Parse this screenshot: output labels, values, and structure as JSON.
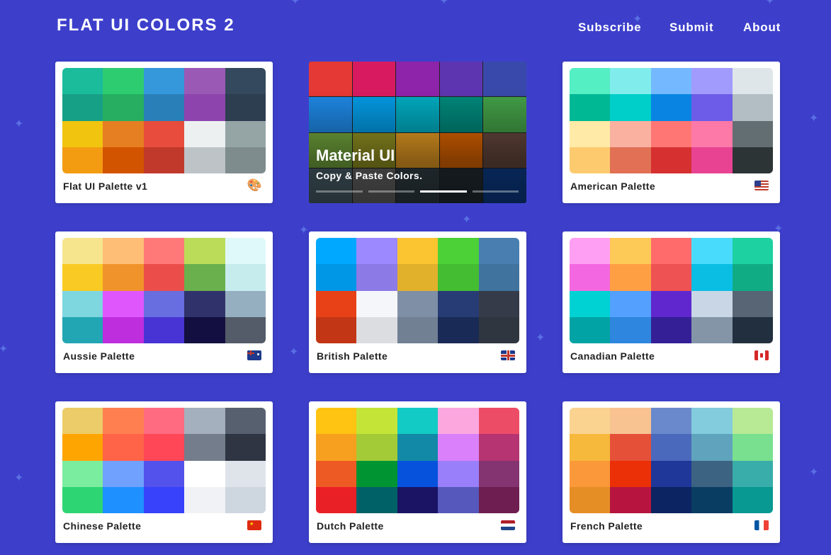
{
  "header": {
    "logo": "FLAT UI COLORS 2",
    "nav": [
      "Subscribe",
      "Submit",
      "About"
    ]
  },
  "featured": {
    "title": "Material UI",
    "subtitle": "Copy & Paste Colors.",
    "colors": [
      "#e53935",
      "#d81b60",
      "#8e24aa",
      "#5e35b1",
      "#3949ab",
      "#1e88e5",
      "#039be5",
      "#00acc1",
      "#00897b",
      "#43a047",
      "#7cb342",
      "#9e9d24",
      "#f9a825",
      "#ef6c00",
      "#6d4c41",
      "#546e7a",
      "#757575",
      "#37474f",
      "#263238",
      "#0d47a1"
    ],
    "carousel_active": 2,
    "carousel_count": 4
  },
  "palettes": [
    {
      "name": "Flat UI Palette v1",
      "icon": "palette-icon",
      "colors": [
        "#1abc9c",
        "#2ecc71",
        "#3498db",
        "#9b59b6",
        "#34495e",
        "#16a085",
        "#27ae60",
        "#2980b9",
        "#8e44ad",
        "#2c3e50",
        "#f1c40f",
        "#e67e22",
        "#e74c3c",
        "#ecf0f1",
        "#95a5a6",
        "#f39c12",
        "#d35400",
        "#c0392b",
        "#bdc3c7",
        "#7f8c8d"
      ]
    },
    {
      "name": "American Palette",
      "icon": "us-flag-icon",
      "colors": [
        "#55efc4",
        "#81ecec",
        "#74b9ff",
        "#a29bfe",
        "#dfe6e9",
        "#00b894",
        "#00cec9",
        "#0984e3",
        "#6c5ce7",
        "#b2bec3",
        "#ffeaa7",
        "#fab1a0",
        "#ff7675",
        "#fd79a8",
        "#636e72",
        "#fdcb6e",
        "#e17055",
        "#d63031",
        "#e84393",
        "#2d3436"
      ]
    },
    {
      "name": "Aussie Palette",
      "icon": "au-flag-icon",
      "colors": [
        "#f6e58d",
        "#ffbe76",
        "#ff7979",
        "#badc58",
        "#dff9fb",
        "#f9ca24",
        "#f0932b",
        "#eb4d4b",
        "#6ab04c",
        "#c7ecee",
        "#7ed6df",
        "#e056fd",
        "#686de0",
        "#30336b",
        "#95afc0",
        "#22a6b3",
        "#be2edd",
        "#4834d4",
        "#130f40",
        "#535c68"
      ]
    },
    {
      "name": "British Palette",
      "icon": "gb-flag-icon",
      "colors": [
        "#00a8ff",
        "#9c88ff",
        "#fbc531",
        "#4cd137",
        "#487eb0",
        "#0097e6",
        "#8c7ae6",
        "#e1b12c",
        "#44bd32",
        "#40739e",
        "#e84118",
        "#f5f6fa",
        "#7f8fa6",
        "#273c75",
        "#353b48",
        "#c23616",
        "#dcdde1",
        "#718093",
        "#192a56",
        "#2f3640"
      ]
    },
    {
      "name": "Canadian Palette",
      "icon": "ca-flag-icon",
      "colors": [
        "#ff9ff3",
        "#feca57",
        "#ff6b6b",
        "#48dbfb",
        "#1dd1a1",
        "#f368e0",
        "#ff9f43",
        "#ee5253",
        "#0abde3",
        "#10ac84",
        "#00d2d3",
        "#54a0ff",
        "#5f27cd",
        "#c8d6e5",
        "#576574",
        "#01a3a4",
        "#2e86de",
        "#341f97",
        "#8395a7",
        "#222f3e"
      ]
    },
    {
      "name": "Chinese Palette",
      "icon": "cn-flag-icon",
      "colors": [
        "#eccc68",
        "#ff7f50",
        "#ff6b81",
        "#a4b0be",
        "#57606f",
        "#ffa502",
        "#ff6348",
        "#ff4757",
        "#747d8c",
        "#2f3542",
        "#7bed9f",
        "#70a1ff",
        "#5352ed",
        "#ffffff",
        "#dfe4ea",
        "#2ed573",
        "#1e90ff",
        "#3742fa",
        "#f1f2f6",
        "#ced6e0"
      ]
    },
    {
      "name": "Dutch Palette",
      "icon": "nl-flag-icon",
      "colors": [
        "#ffc312",
        "#c4e538",
        "#12cbc4",
        "#fda7df",
        "#ed4c67",
        "#f79f1f",
        "#a3cb38",
        "#1289a7",
        "#d980fa",
        "#b53471",
        "#ee5a24",
        "#009432",
        "#0652dd",
        "#9980fa",
        "#833471",
        "#ea2027",
        "#006266",
        "#1b1464",
        "#5758bb",
        "#6f1e51"
      ]
    },
    {
      "name": "French Palette",
      "icon": "fr-flag-icon",
      "colors": [
        "#fad390",
        "#f8c291",
        "#6a89cc",
        "#82ccdd",
        "#b8e994",
        "#f6b93b",
        "#e55039",
        "#4a69bd",
        "#60a3bc",
        "#78e08f",
        "#fa983a",
        "#eb2f06",
        "#1e3799",
        "#3c6382",
        "#38ada9",
        "#e58e26",
        "#b71540",
        "#0c2461",
        "#0a3d62",
        "#079992"
      ]
    }
  ]
}
